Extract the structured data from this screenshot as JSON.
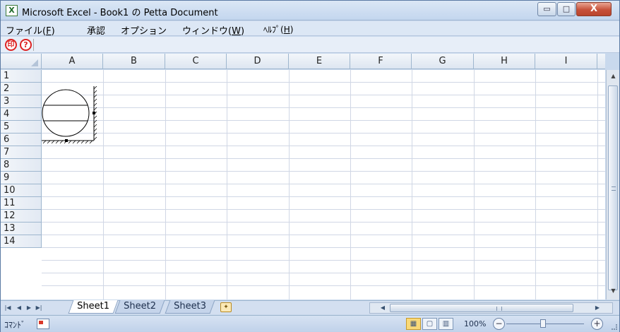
{
  "window": {
    "app_icon": "X",
    "title": "Microsoft Excel - Book1 の Petta Document",
    "buttons": {
      "minimize": "▭",
      "maximize": "□",
      "close": "X"
    }
  },
  "menubar": {
    "items": [
      {
        "label": "ファイル(",
        "accel": "F",
        "suffix": ")"
      },
      {
        "label": "承認",
        "accel": "",
        "suffix": ""
      },
      {
        "label": "オプション",
        "accel": "",
        "suffix": ""
      },
      {
        "label": "ウィンドウ(",
        "accel": "W",
        "suffix": ")"
      },
      {
        "label": "ﾍﾙﾌﾟ(",
        "accel": "H",
        "suffix": ")"
      }
    ]
  },
  "toolbar": {
    "icons": [
      {
        "name": "approval-stamp-icon",
        "glyph": "印"
      },
      {
        "name": "help-icon",
        "glyph": "?"
      }
    ]
  },
  "grid": {
    "columns": [
      "A",
      "B",
      "C",
      "D",
      "E",
      "F",
      "G",
      "H",
      "I"
    ],
    "rows": [
      "1",
      "2",
      "3",
      "4",
      "5",
      "6",
      "7",
      "8",
      "9",
      "10",
      "11",
      "12",
      "13",
      "14"
    ]
  },
  "sheet_tabs": {
    "nav": [
      "|◀",
      "◀",
      "▶",
      "▶|"
    ],
    "tabs": [
      "Sheet1",
      "Sheet2",
      "Sheet3"
    ],
    "active": "Sheet1",
    "new_sheet_icon": "new-sheet-icon"
  },
  "statusbar": {
    "mode": "ｺﾏﾝﾄﾞ",
    "zoom": "100%",
    "zoom_minus": "−",
    "zoom_plus": "+"
  },
  "colors": {
    "title_gradient_top": "#dbe7f5",
    "header_border": "#9eb6ce",
    "gridline": "#d0d7e5",
    "close_button": "#c7513a",
    "toolbar_icon": "#dd2222"
  }
}
